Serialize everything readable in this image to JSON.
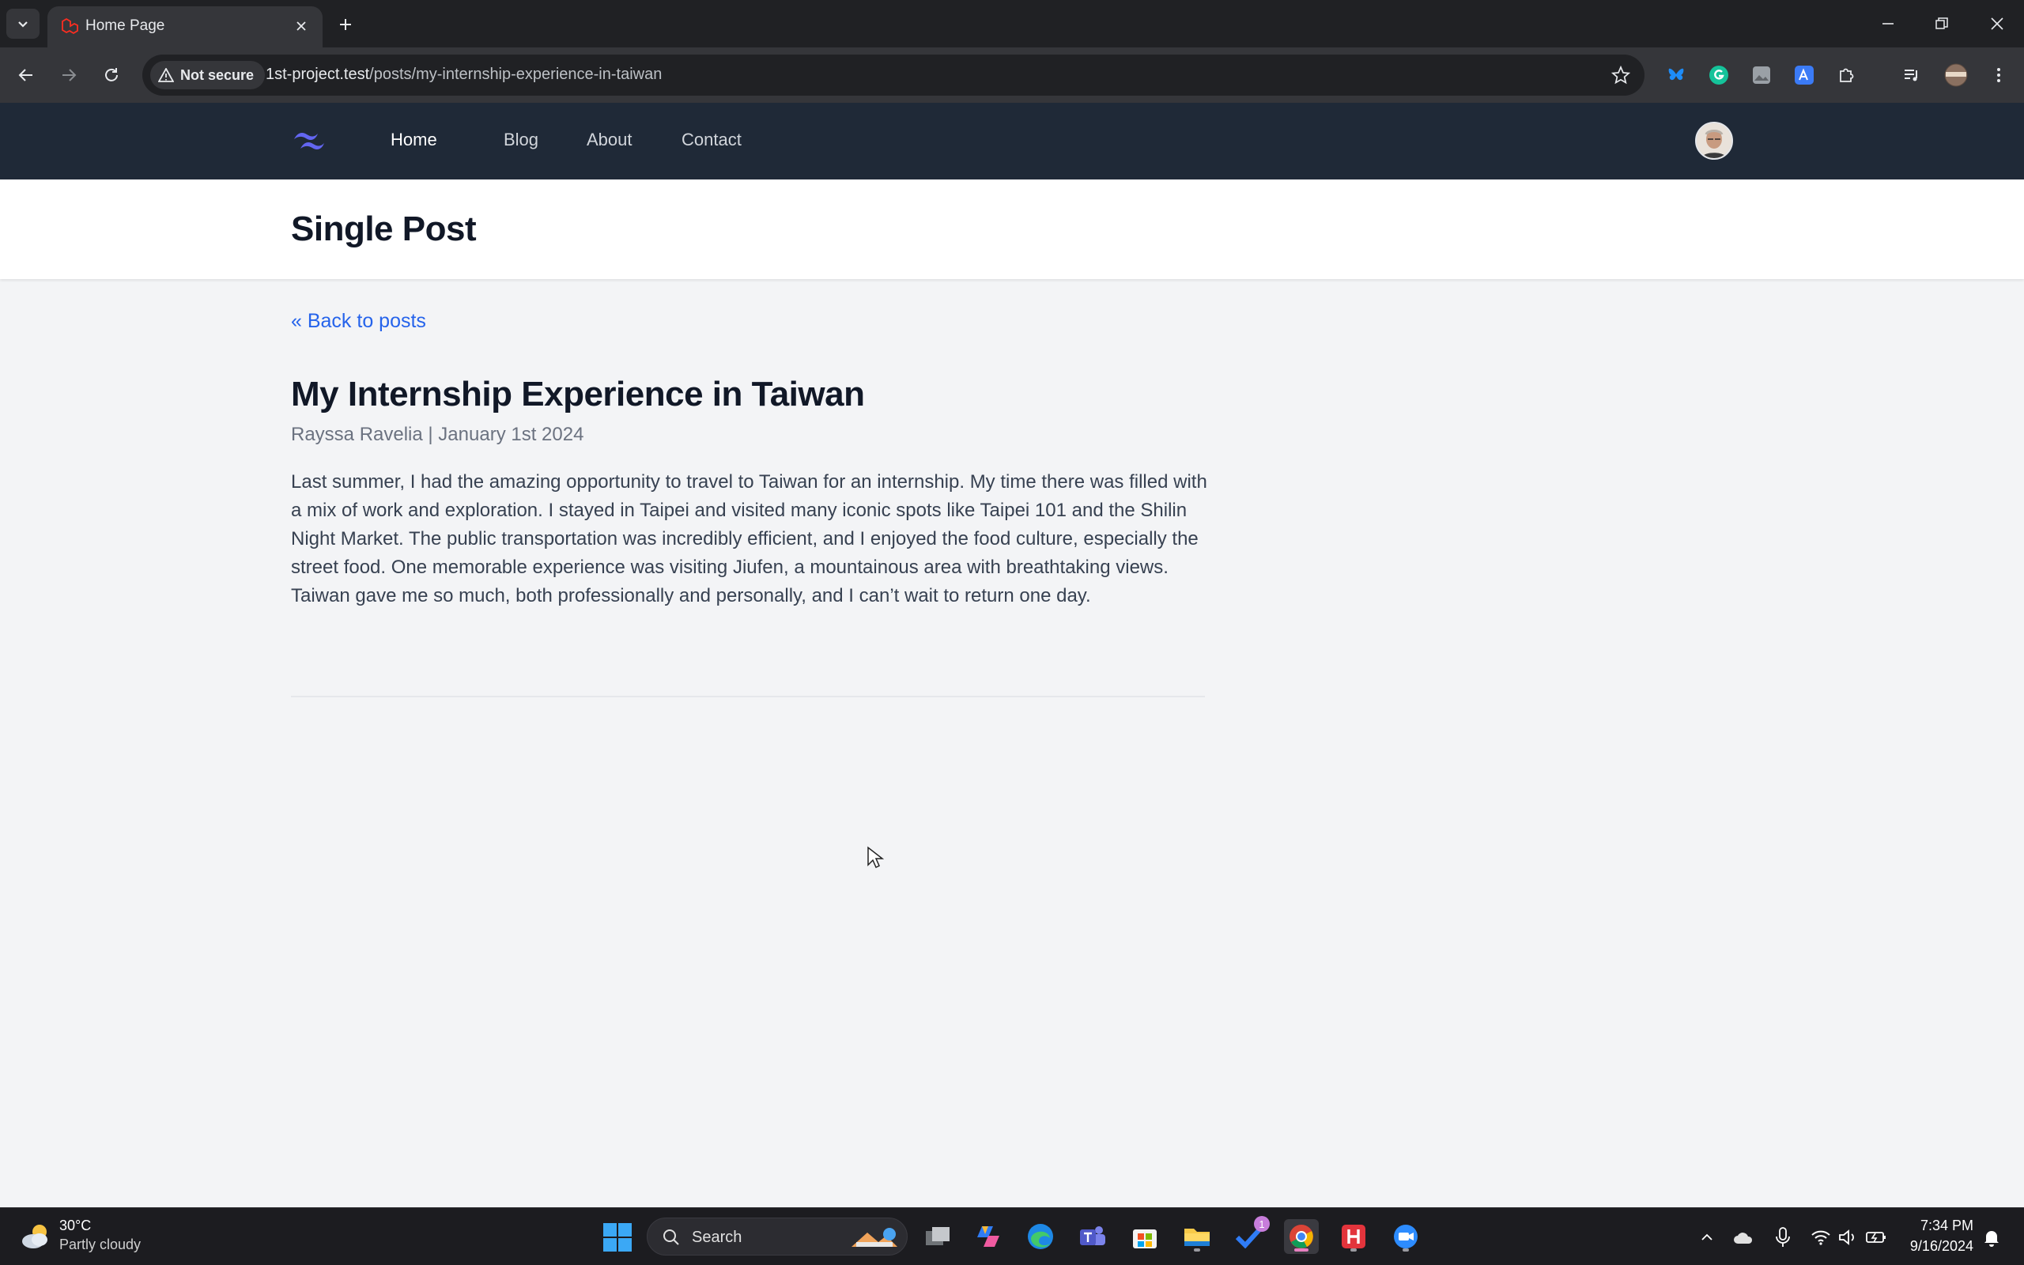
{
  "browser": {
    "tab_title": "Home Page",
    "security_label": "Not secure",
    "url_host": "1st-project.test",
    "url_path": "/posts/my-internship-experience-in-taiwan"
  },
  "site": {
    "nav": [
      "Home",
      "Blog",
      "About",
      "Contact"
    ],
    "active_nav": "Home",
    "page_title": "Single Post",
    "back_link": "« Back to posts",
    "post": {
      "title": "My Internship Experience in Taiwan",
      "meta": "Rayssa Ravelia | January 1st 2024",
      "body": "Last summer, I had the amazing opportunity to travel to Taiwan for an internship. My time there was filled with a mix of work and exploration. I stayed in Taipei and visited many iconic spots like Taipei 101 and the Shilin Night Market. The public transportation was incredibly efficient, and I enjoyed the food culture, especially the street food. One memorable experience was visiting Jiufen, a mountainous area with breathtaking views. Taiwan gave me so much, both professionally and personally, and I can’t wait to return one day."
    }
  },
  "taskbar": {
    "weather_temp": "30°C",
    "weather_desc": "Partly cloudy",
    "search_label": "Search",
    "todo_badge": "1",
    "time": "7:34 PM",
    "date": "9/16/2024"
  },
  "colors": {
    "nav_bg": "#1f2937",
    "link": "#2563eb",
    "logo": "#6366f1"
  }
}
